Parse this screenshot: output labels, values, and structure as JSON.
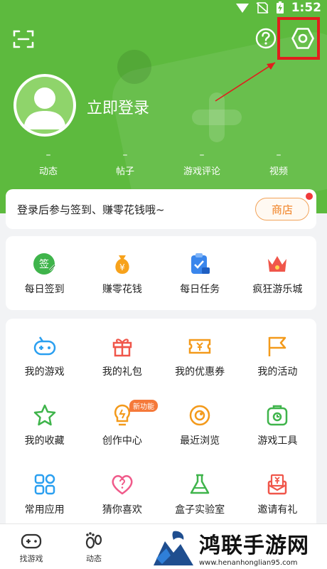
{
  "status_bar": {
    "time": "1:52"
  },
  "profile": {
    "login_label": "立即登录"
  },
  "stats": [
    {
      "value": "–",
      "label": "动态"
    },
    {
      "value": "–",
      "label": "帖子"
    },
    {
      "value": "–",
      "label": "游戏评论"
    },
    {
      "value": "–",
      "label": "视频"
    }
  ],
  "promo": {
    "text": "登录后参与签到、赚零花钱哦~",
    "shop_label": "商店"
  },
  "quick_actions": [
    {
      "label": "每日签到",
      "icon": "sign-in-icon",
      "badge_text": "签"
    },
    {
      "label": "赚零花钱",
      "icon": "money-bag-icon",
      "badge_text": "¥"
    },
    {
      "label": "每日任务",
      "icon": "task-clipboard-icon"
    },
    {
      "label": "疯狂游乐城",
      "icon": "crown-icon"
    }
  ],
  "menu": [
    {
      "label": "我的游戏",
      "icon": "gamepad-icon"
    },
    {
      "label": "我的礼包",
      "icon": "gift-icon"
    },
    {
      "label": "我的优惠券",
      "icon": "coupon-icon"
    },
    {
      "label": "我的活动",
      "icon": "flag-icon"
    },
    {
      "label": "我的收藏",
      "icon": "star-icon"
    },
    {
      "label": "创作中心",
      "icon": "bulb-icon",
      "badge": "新功能"
    },
    {
      "label": "最近浏览",
      "icon": "eye-icon"
    },
    {
      "label": "游戏工具",
      "icon": "toolbox-icon"
    },
    {
      "label": "常用应用",
      "icon": "apps-icon"
    },
    {
      "label": "猜你喜欢",
      "icon": "heart-question-icon"
    },
    {
      "label": "盒子实验室",
      "icon": "flask-icon"
    },
    {
      "label": "邀请有礼",
      "icon": "invite-gift-icon"
    }
  ],
  "tabs": [
    {
      "label": "找游戏",
      "icon": "gamepad-tab-icon"
    },
    {
      "label": "动态",
      "icon": "footprint-icon"
    }
  ],
  "watermark": {
    "title": "鸿联手游网",
    "url": "www.henanhonglian95.com"
  },
  "colors": {
    "brand_green": "#5dba3e",
    "accent_orange": "#f07f1f",
    "highlight_red": "#e11d1d"
  }
}
